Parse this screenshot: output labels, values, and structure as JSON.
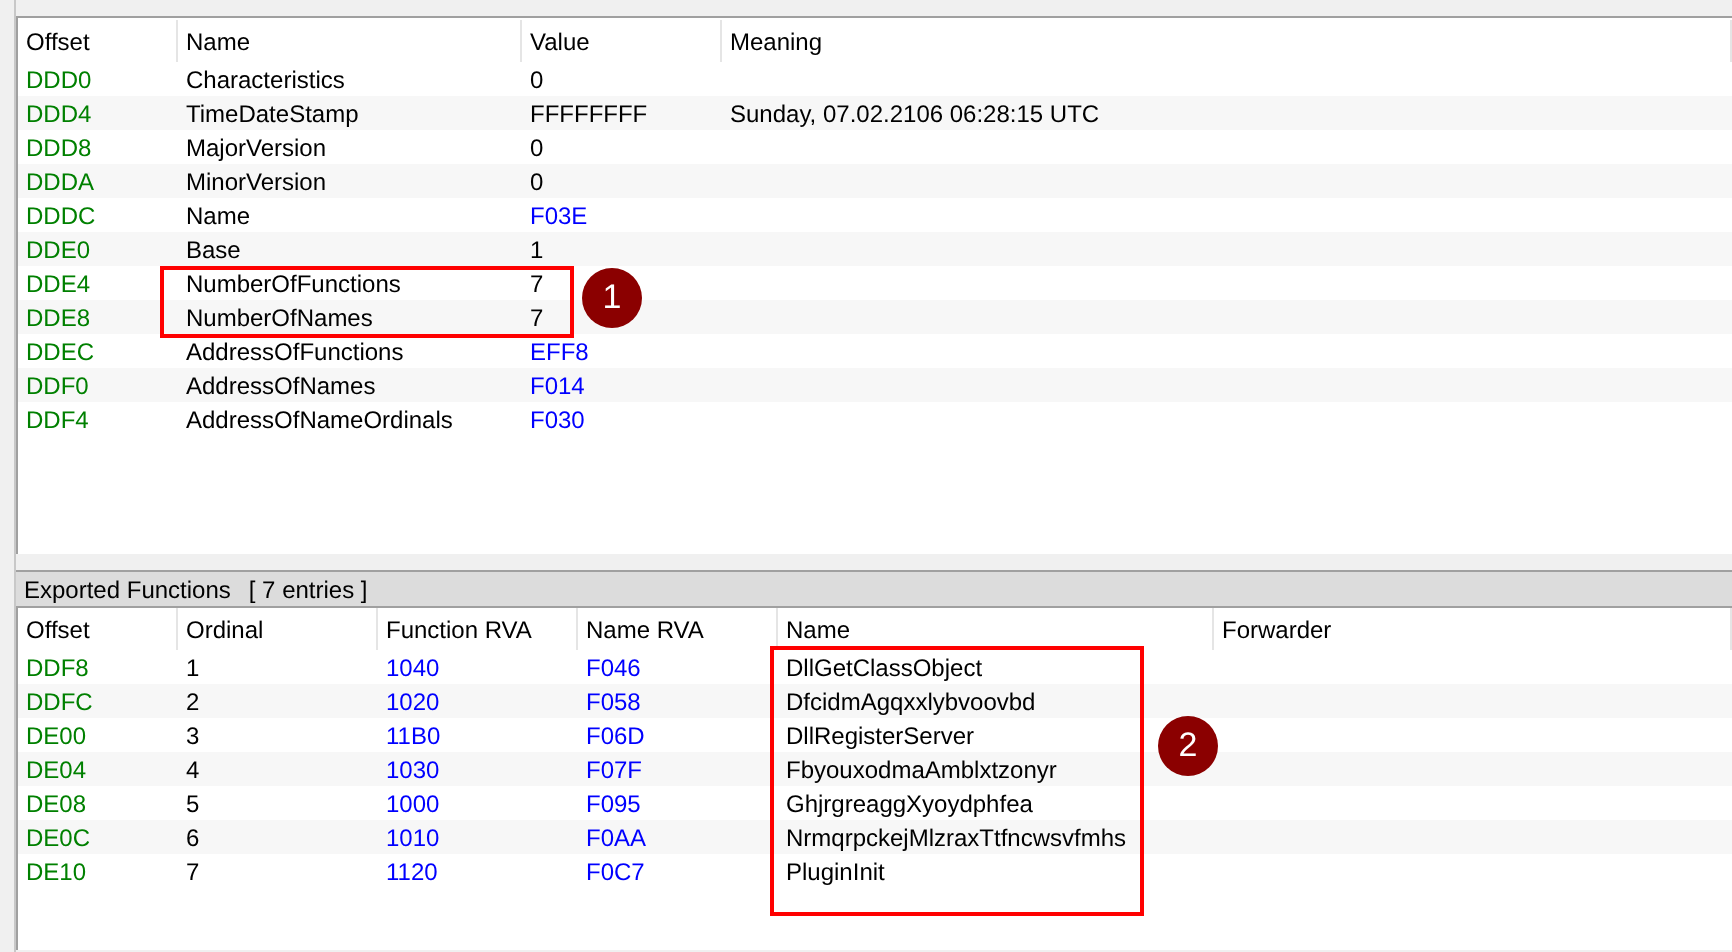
{
  "header_table": {
    "columns": [
      "Offset",
      "Name",
      "Value",
      "Meaning"
    ],
    "rows": [
      {
        "offset": "DDD0",
        "name": "Characteristics",
        "value": "0",
        "is_address": false
      },
      {
        "offset": "DDD4",
        "name": "TimeDateStamp",
        "value": "FFFFFFFF",
        "is_address": false,
        "meaning": "Sunday, 07.02.2106 06:28:15 UTC"
      },
      {
        "offset": "DDD8",
        "name": "MajorVersion",
        "value": "0",
        "is_address": false
      },
      {
        "offset": "DDDA",
        "name": "MinorVersion",
        "value": "0",
        "is_address": false
      },
      {
        "offset": "DDDC",
        "name": "Name",
        "value": "F03E",
        "is_address": true
      },
      {
        "offset": "DDE0",
        "name": "Base",
        "value": "1",
        "is_address": false
      },
      {
        "offset": "DDE4",
        "name": "NumberOfFunctions",
        "value": "7",
        "is_address": false
      },
      {
        "offset": "DDE8",
        "name": "NumberOfNames",
        "value": "7",
        "is_address": false
      },
      {
        "offset": "DDEC",
        "name": "AddressOfFunctions",
        "value": "EFF8",
        "is_address": true
      },
      {
        "offset": "DDF0",
        "name": "AddressOfNames",
        "value": "F014",
        "is_address": true
      },
      {
        "offset": "DDF4",
        "name": "AddressOfNameOrdinals",
        "value": "F030",
        "is_address": true
      }
    ]
  },
  "exports": {
    "title": "Exported Functions",
    "count": "[ 7 entries ]",
    "columns": [
      "Offset",
      "Ordinal",
      "Function RVA",
      "Name RVA",
      "Name",
      "Forwarder"
    ],
    "rows": [
      {
        "offset": "DDF8",
        "ordinal": "1",
        "function_rva": "1040",
        "name_rva": "F046",
        "name": "DllGetClassObject"
      },
      {
        "offset": "DDFC",
        "ordinal": "2",
        "function_rva": "1020",
        "name_rva": "F058",
        "name": "DfcidmAgqxxlybvoovbd"
      },
      {
        "offset": "DE00",
        "ordinal": "3",
        "function_rva": "11B0",
        "name_rva": "F06D",
        "name": "DllRegisterServer"
      },
      {
        "offset": "DE04",
        "ordinal": "4",
        "function_rva": "1030",
        "name_rva": "F07F",
        "name": "FbyouxodmaAmblxtzonyr"
      },
      {
        "offset": "DE08",
        "ordinal": "5",
        "function_rva": "1000",
        "name_rva": "F095",
        "name": "GhjrgreaggXyoydphfea"
      },
      {
        "offset": "DE0C",
        "ordinal": "6",
        "function_rva": "1010",
        "name_rva": "F0AA",
        "name": "NrmqrpckejMlzraxTtfncwsvfmhs"
      },
      {
        "offset": "DE10",
        "ordinal": "7",
        "function_rva": "1120",
        "name_rva": "F0C7",
        "name": "PluginInit"
      }
    ]
  },
  "annotations": [
    {
      "label": "1"
    },
    {
      "label": "2"
    }
  ]
}
